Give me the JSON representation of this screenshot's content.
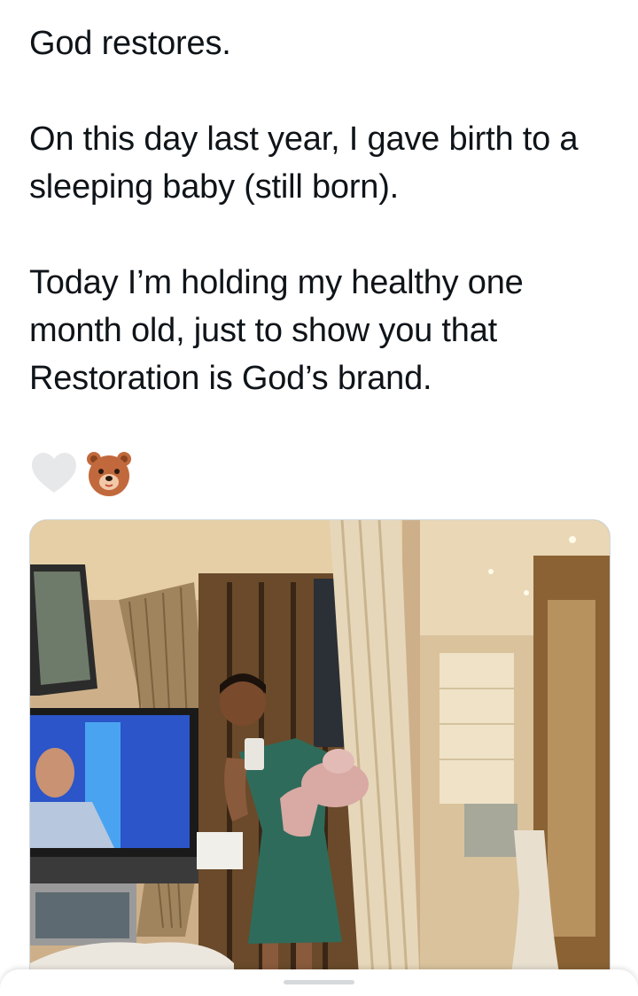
{
  "post": {
    "text": "God restores.\n\nOn this day last year, I gave birth to a sleeping baby (still born).\n\nToday I’m holding my healthy one month old, just to show you that Restoration is God’s brand."
  },
  "emojis": [
    "white-heart",
    "bear-face"
  ],
  "media": {
    "type": "photo",
    "subject": "mirror-selfie-holding-baby"
  },
  "colors": {
    "background": "#ffffff",
    "text": "#0f1419",
    "dress": "#2f6b5a",
    "baby_suit": "#d9a9a4"
  }
}
